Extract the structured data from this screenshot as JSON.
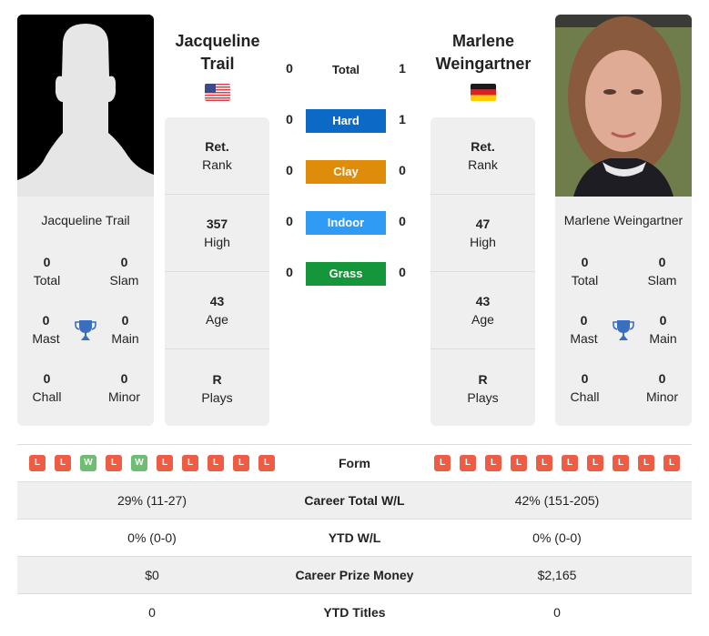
{
  "colors": {
    "hard": "#0c6ac6",
    "clay": "#e08c0b",
    "indoor": "#2f9bf4",
    "grass": "#16963a",
    "loss": "#ee5c45",
    "win": "#6dbd72",
    "trophy": "#3a6fc0",
    "card_bg": "#efefef"
  },
  "player1": {
    "name_line1": "Jacqueline",
    "name_line2": "Trail",
    "full_name": "Jacqueline Trail",
    "country_flag": "usa-flag",
    "rank": {
      "value": "Ret.",
      "label": "Rank"
    },
    "high": {
      "value": "357",
      "label": "High"
    },
    "age": {
      "value": "43",
      "label": "Age"
    },
    "plays": {
      "value": "R",
      "label": "Plays"
    },
    "titles": {
      "total": {
        "value": "0",
        "label": "Total"
      },
      "slam": {
        "value": "0",
        "label": "Slam"
      },
      "mast": {
        "value": "0",
        "label": "Mast"
      },
      "main": {
        "value": "0",
        "label": "Main"
      },
      "chall": {
        "value": "0",
        "label": "Chall"
      },
      "minor": {
        "value": "0",
        "label": "Minor"
      }
    },
    "form": [
      "L",
      "L",
      "W",
      "L",
      "W",
      "L",
      "L",
      "L",
      "L",
      "L"
    ]
  },
  "player2": {
    "name_line1": "Marlene",
    "name_line2": "Weingartner",
    "full_name": "Marlene Weingartner",
    "country_flag": "germany-flag",
    "rank": {
      "value": "Ret.",
      "label": "Rank"
    },
    "high": {
      "value": "47",
      "label": "High"
    },
    "age": {
      "value": "43",
      "label": "Age"
    },
    "plays": {
      "value": "R",
      "label": "Plays"
    },
    "titles": {
      "total": {
        "value": "0",
        "label": "Total"
      },
      "slam": {
        "value": "0",
        "label": "Slam"
      },
      "mast": {
        "value": "0",
        "label": "Mast"
      },
      "main": {
        "value": "0",
        "label": "Main"
      },
      "chall": {
        "value": "0",
        "label": "Chall"
      },
      "minor": {
        "value": "0",
        "label": "Minor"
      }
    },
    "form": [
      "L",
      "L",
      "L",
      "L",
      "L",
      "L",
      "L",
      "L",
      "L",
      "L"
    ]
  },
  "h2h": [
    {
      "label": "Total",
      "p1": "0",
      "p2": "1",
      "key": "total"
    },
    {
      "label": "Hard",
      "p1": "0",
      "p2": "1",
      "key": "hard"
    },
    {
      "label": "Clay",
      "p1": "0",
      "p2": "0",
      "key": "clay"
    },
    {
      "label": "Indoor",
      "p1": "0",
      "p2": "0",
      "key": "indoor"
    },
    {
      "label": "Grass",
      "p1": "0",
      "p2": "0",
      "key": "grass"
    }
  ],
  "stats": {
    "form_label": "Form",
    "rows": [
      {
        "label": "Career Total W/L",
        "p1": "29% (11-27)",
        "p2": "42% (151-205)"
      },
      {
        "label": "YTD W/L",
        "p1": "0% (0-0)",
        "p2": "0% (0-0)"
      },
      {
        "label": "Career Prize Money",
        "p1": "$0",
        "p2": "$2,165"
      },
      {
        "label": "YTD Titles",
        "p1": "0",
        "p2": "0"
      }
    ]
  }
}
